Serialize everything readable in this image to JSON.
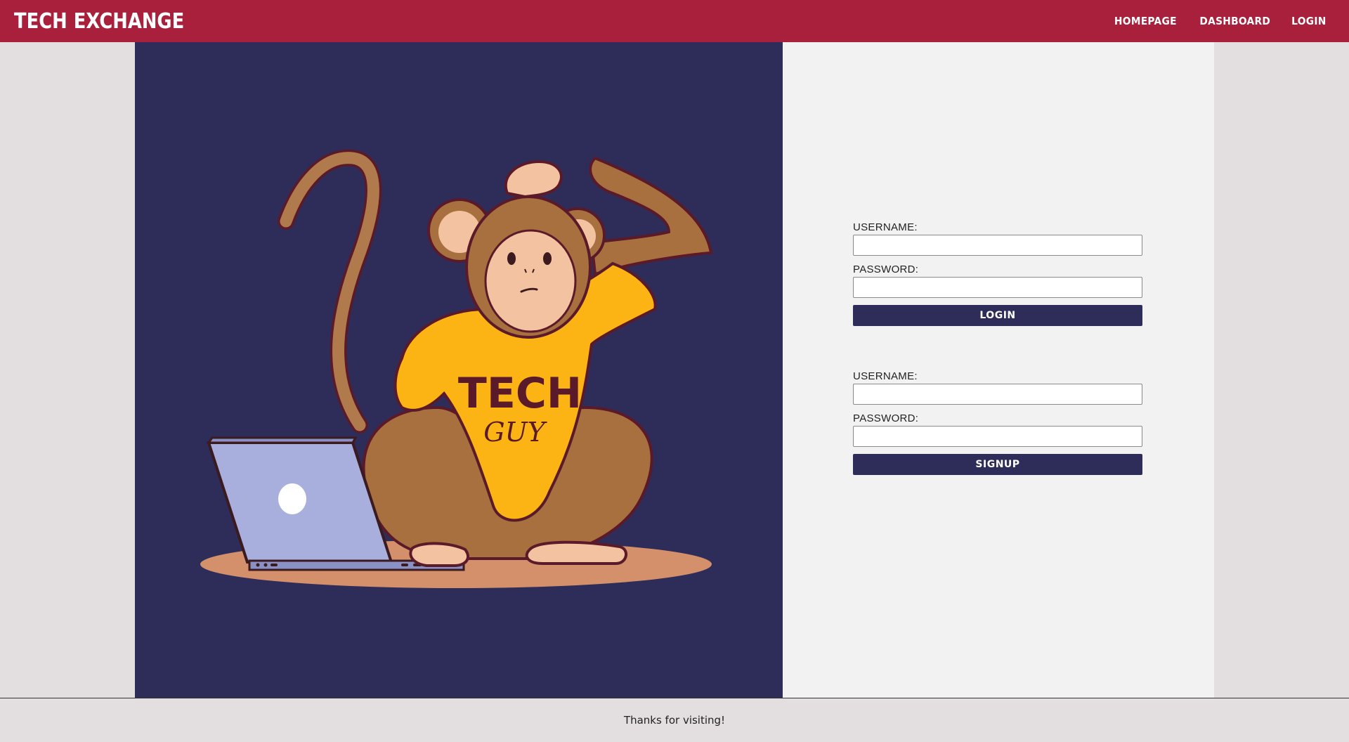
{
  "navbar": {
    "brand": "TECH EXCHANGE",
    "links": [
      "HOMEPAGE",
      "DASHBOARD",
      "LOGIN"
    ]
  },
  "hero": {
    "illustration": "monkey-in-tech-guy-shirt-with-laptop",
    "shirt_text_line1": "TECH",
    "shirt_text_line2": "GUY"
  },
  "login_form": {
    "username_label": "USERNAME:",
    "password_label": "PASSWORD:",
    "username_value": "",
    "password_value": "",
    "submit_label": "LOGIN"
  },
  "signup_form": {
    "username_label": "USERNAME:",
    "password_label": "PASSWORD:",
    "username_value": "",
    "password_value": "",
    "submit_label": "SIGNUP"
  },
  "footer": {
    "text": "Thanks for visiting!"
  },
  "colors": {
    "navbar": "#a8203b",
    "hero_bg": "#2e2d59",
    "button": "#2e2d59",
    "panel_bg": "#f2f2f2",
    "page_bg": "#e3dfe0"
  }
}
